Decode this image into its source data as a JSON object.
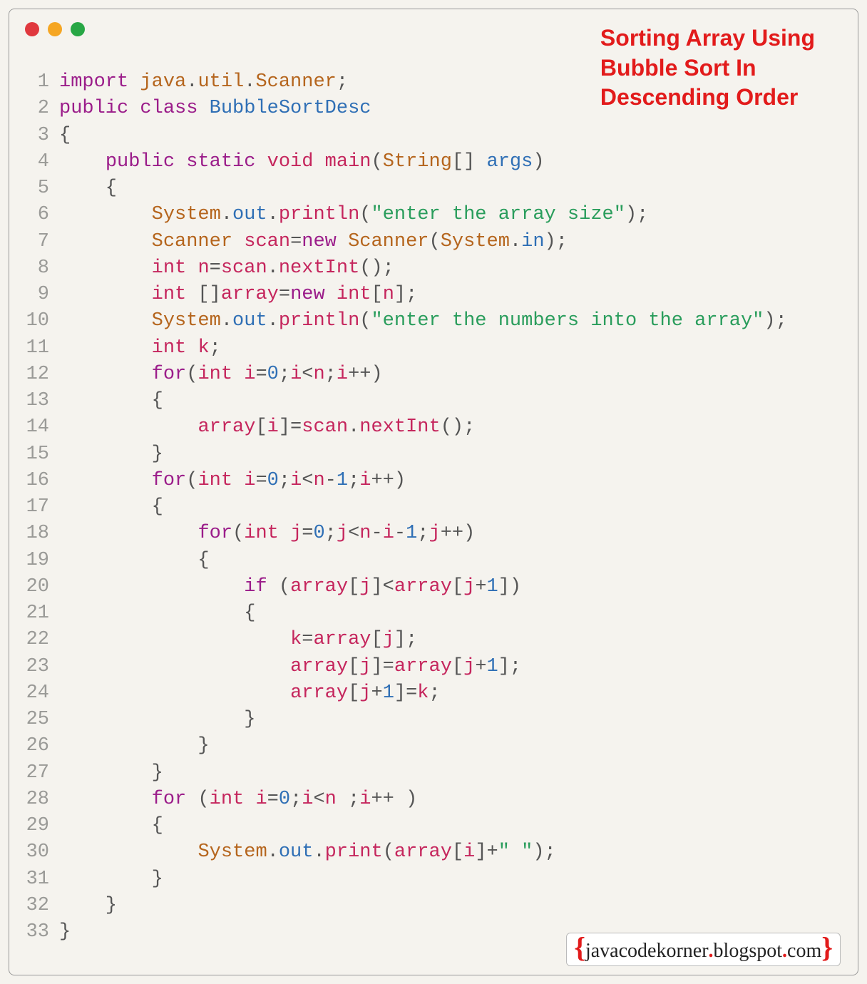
{
  "title": "Sorting Array Using\nBubble Sort In\nDescending Order",
  "footer": {
    "left_brace": "{",
    "text1": "javacodekorner",
    "dot": ".",
    "text2": "blogspot",
    "dot2": ".",
    "text3": "com",
    "right_brace": "}"
  },
  "lines": [
    {
      "n": "1",
      "t": [
        [
          "kw",
          "import"
        ],
        [
          "pun",
          " "
        ],
        [
          "cls",
          "java"
        ],
        [
          "pun",
          "."
        ],
        [
          "cls",
          "util"
        ],
        [
          "pun",
          "."
        ],
        [
          "cls",
          "Scanner"
        ],
        [
          "pun",
          ";"
        ]
      ]
    },
    {
      "n": "2",
      "t": [
        [
          "kw",
          "public"
        ],
        [
          "pun",
          " "
        ],
        [
          "kw",
          "class"
        ],
        [
          "pun",
          " "
        ],
        [
          "idb",
          "BubbleSortDesc"
        ]
      ]
    },
    {
      "n": "3",
      "t": [
        [
          "pun",
          "{"
        ]
      ]
    },
    {
      "n": "4",
      "t": [
        [
          "pun",
          "    "
        ],
        [
          "kw",
          "public"
        ],
        [
          "pun",
          " "
        ],
        [
          "kw",
          "static"
        ],
        [
          "pun",
          " "
        ],
        [
          "typ",
          "void"
        ],
        [
          "pun",
          " "
        ],
        [
          "mth",
          "main"
        ],
        [
          "pun",
          "("
        ],
        [
          "cls",
          "String"
        ],
        [
          "pun",
          "[] "
        ],
        [
          "idb",
          "args"
        ],
        [
          "pun",
          ")"
        ]
      ]
    },
    {
      "n": "5",
      "t": [
        [
          "pun",
          "    {"
        ]
      ]
    },
    {
      "n": "6",
      "t": [
        [
          "pun",
          "        "
        ],
        [
          "cls",
          "System"
        ],
        [
          "pun",
          "."
        ],
        [
          "idb",
          "out"
        ],
        [
          "pun",
          "."
        ],
        [
          "mth",
          "println"
        ],
        [
          "pun",
          "("
        ],
        [
          "str",
          "\"enter the array size\""
        ],
        [
          "pun",
          ");"
        ]
      ]
    },
    {
      "n": "7",
      "t": [
        [
          "pun",
          "        "
        ],
        [
          "cls",
          "Scanner"
        ],
        [
          "pun",
          " "
        ],
        [
          "var",
          "scan"
        ],
        [
          "pun",
          "="
        ],
        [
          "kw",
          "new"
        ],
        [
          "pun",
          " "
        ],
        [
          "cls",
          "Scanner"
        ],
        [
          "pun",
          "("
        ],
        [
          "cls",
          "System"
        ],
        [
          "pun",
          "."
        ],
        [
          "idb",
          "in"
        ],
        [
          "pun",
          ");"
        ]
      ]
    },
    {
      "n": "8",
      "t": [
        [
          "pun",
          "        "
        ],
        [
          "typ",
          "int"
        ],
        [
          "pun",
          " "
        ],
        [
          "var",
          "n"
        ],
        [
          "pun",
          "="
        ],
        [
          "var",
          "scan"
        ],
        [
          "pun",
          "."
        ],
        [
          "mth",
          "nextInt"
        ],
        [
          "pun",
          "();"
        ]
      ]
    },
    {
      "n": "9",
      "t": [
        [
          "pun",
          "        "
        ],
        [
          "typ",
          "int"
        ],
        [
          "pun",
          " []"
        ],
        [
          "var",
          "array"
        ],
        [
          "pun",
          "="
        ],
        [
          "kw",
          "new"
        ],
        [
          "pun",
          " "
        ],
        [
          "typ",
          "int"
        ],
        [
          "pun",
          "["
        ],
        [
          "var",
          "n"
        ],
        [
          "pun",
          "];"
        ]
      ]
    },
    {
      "n": "10",
      "t": [
        [
          "pun",
          "        "
        ],
        [
          "cls",
          "System"
        ],
        [
          "pun",
          "."
        ],
        [
          "idb",
          "out"
        ],
        [
          "pun",
          "."
        ],
        [
          "mth",
          "println"
        ],
        [
          "pun",
          "("
        ],
        [
          "str",
          "\"enter the numbers into the array\""
        ],
        [
          "pun",
          ");"
        ]
      ]
    },
    {
      "n": "11",
      "t": [
        [
          "pun",
          "        "
        ],
        [
          "typ",
          "int"
        ],
        [
          "pun",
          " "
        ],
        [
          "var",
          "k"
        ],
        [
          "pun",
          ";"
        ]
      ]
    },
    {
      "n": "12",
      "t": [
        [
          "pun",
          "        "
        ],
        [
          "kw",
          "for"
        ],
        [
          "pun",
          "("
        ],
        [
          "typ",
          "int"
        ],
        [
          "pun",
          " "
        ],
        [
          "var",
          "i"
        ],
        [
          "pun",
          "="
        ],
        [
          "num",
          "0"
        ],
        [
          "pun",
          ";"
        ],
        [
          "var",
          "i"
        ],
        [
          "pun",
          "<"
        ],
        [
          "var",
          "n"
        ],
        [
          "pun",
          ";"
        ],
        [
          "var",
          "i"
        ],
        [
          "pun",
          "++)"
        ]
      ]
    },
    {
      "n": "13",
      "t": [
        [
          "pun",
          "        {"
        ]
      ]
    },
    {
      "n": "14",
      "t": [
        [
          "pun",
          "            "
        ],
        [
          "var",
          "array"
        ],
        [
          "pun",
          "["
        ],
        [
          "var",
          "i"
        ],
        [
          "pun",
          "]="
        ],
        [
          "var",
          "scan"
        ],
        [
          "pun",
          "."
        ],
        [
          "mth",
          "nextInt"
        ],
        [
          "pun",
          "();"
        ]
      ]
    },
    {
      "n": "15",
      "t": [
        [
          "pun",
          "        }"
        ]
      ]
    },
    {
      "n": "16",
      "t": [
        [
          "pun",
          "        "
        ],
        [
          "kw",
          "for"
        ],
        [
          "pun",
          "("
        ],
        [
          "typ",
          "int"
        ],
        [
          "pun",
          " "
        ],
        [
          "var",
          "i"
        ],
        [
          "pun",
          "="
        ],
        [
          "num",
          "0"
        ],
        [
          "pun",
          ";"
        ],
        [
          "var",
          "i"
        ],
        [
          "pun",
          "<"
        ],
        [
          "var",
          "n"
        ],
        [
          "pun",
          "-"
        ],
        [
          "num",
          "1"
        ],
        [
          "pun",
          ";"
        ],
        [
          "var",
          "i"
        ],
        [
          "pun",
          "++)"
        ]
      ]
    },
    {
      "n": "17",
      "t": [
        [
          "pun",
          "        {"
        ]
      ]
    },
    {
      "n": "18",
      "t": [
        [
          "pun",
          "            "
        ],
        [
          "kw",
          "for"
        ],
        [
          "pun",
          "("
        ],
        [
          "typ",
          "int"
        ],
        [
          "pun",
          " "
        ],
        [
          "var",
          "j"
        ],
        [
          "pun",
          "="
        ],
        [
          "num",
          "0"
        ],
        [
          "pun",
          ";"
        ],
        [
          "var",
          "j"
        ],
        [
          "pun",
          "<"
        ],
        [
          "var",
          "n"
        ],
        [
          "pun",
          "-"
        ],
        [
          "var",
          "i"
        ],
        [
          "pun",
          "-"
        ],
        [
          "num",
          "1"
        ],
        [
          "pun",
          ";"
        ],
        [
          "var",
          "j"
        ],
        [
          "pun",
          "++)"
        ]
      ]
    },
    {
      "n": "19",
      "t": [
        [
          "pun",
          "            {"
        ]
      ]
    },
    {
      "n": "20",
      "t": [
        [
          "pun",
          "                "
        ],
        [
          "kw",
          "if"
        ],
        [
          "pun",
          " ("
        ],
        [
          "var",
          "array"
        ],
        [
          "pun",
          "["
        ],
        [
          "var",
          "j"
        ],
        [
          "pun",
          "]<"
        ],
        [
          "var",
          "array"
        ],
        [
          "pun",
          "["
        ],
        [
          "var",
          "j"
        ],
        [
          "pun",
          "+"
        ],
        [
          "num",
          "1"
        ],
        [
          "pun",
          "])"
        ]
      ]
    },
    {
      "n": "21",
      "t": [
        [
          "pun",
          "                {"
        ]
      ]
    },
    {
      "n": "22",
      "t": [
        [
          "pun",
          "                    "
        ],
        [
          "var",
          "k"
        ],
        [
          "pun",
          "="
        ],
        [
          "var",
          "array"
        ],
        [
          "pun",
          "["
        ],
        [
          "var",
          "j"
        ],
        [
          "pun",
          "];"
        ]
      ]
    },
    {
      "n": "23",
      "t": [
        [
          "pun",
          "                    "
        ],
        [
          "var",
          "array"
        ],
        [
          "pun",
          "["
        ],
        [
          "var",
          "j"
        ],
        [
          "pun",
          "]="
        ],
        [
          "var",
          "array"
        ],
        [
          "pun",
          "["
        ],
        [
          "var",
          "j"
        ],
        [
          "pun",
          "+"
        ],
        [
          "num",
          "1"
        ],
        [
          "pun",
          "];"
        ]
      ]
    },
    {
      "n": "24",
      "t": [
        [
          "pun",
          "                    "
        ],
        [
          "var",
          "array"
        ],
        [
          "pun",
          "["
        ],
        [
          "var",
          "j"
        ],
        [
          "pun",
          "+"
        ],
        [
          "num",
          "1"
        ],
        [
          "pun",
          "]="
        ],
        [
          "var",
          "k"
        ],
        [
          "pun",
          ";"
        ]
      ]
    },
    {
      "n": "25",
      "t": [
        [
          "pun",
          "                }"
        ]
      ]
    },
    {
      "n": "26",
      "t": [
        [
          "pun",
          "            }"
        ]
      ]
    },
    {
      "n": "27",
      "t": [
        [
          "pun",
          "        }"
        ]
      ]
    },
    {
      "n": "28",
      "t": [
        [
          "pun",
          "        "
        ],
        [
          "kw",
          "for"
        ],
        [
          "pun",
          " ("
        ],
        [
          "typ",
          "int"
        ],
        [
          "pun",
          " "
        ],
        [
          "var",
          "i"
        ],
        [
          "pun",
          "="
        ],
        [
          "num",
          "0"
        ],
        [
          "pun",
          ";"
        ],
        [
          "var",
          "i"
        ],
        [
          "pun",
          "<"
        ],
        [
          "var",
          "n"
        ],
        [
          "pun",
          " ;"
        ],
        [
          "var",
          "i"
        ],
        [
          "pun",
          "++ )"
        ]
      ]
    },
    {
      "n": "29",
      "t": [
        [
          "pun",
          "        {"
        ]
      ]
    },
    {
      "n": "30",
      "t": [
        [
          "pun",
          "            "
        ],
        [
          "cls",
          "System"
        ],
        [
          "pun",
          "."
        ],
        [
          "idb",
          "out"
        ],
        [
          "pun",
          "."
        ],
        [
          "mth",
          "print"
        ],
        [
          "pun",
          "("
        ],
        [
          "var",
          "array"
        ],
        [
          "pun",
          "["
        ],
        [
          "var",
          "i"
        ],
        [
          "pun",
          "]+"
        ],
        [
          "str",
          "\" \""
        ],
        [
          "pun",
          ");"
        ]
      ]
    },
    {
      "n": "31",
      "t": [
        [
          "pun",
          "        }"
        ]
      ]
    },
    {
      "n": "32",
      "t": [
        [
          "pun",
          "    }"
        ]
      ]
    },
    {
      "n": "33",
      "t": [
        [
          "pun",
          "}"
        ]
      ]
    }
  ]
}
